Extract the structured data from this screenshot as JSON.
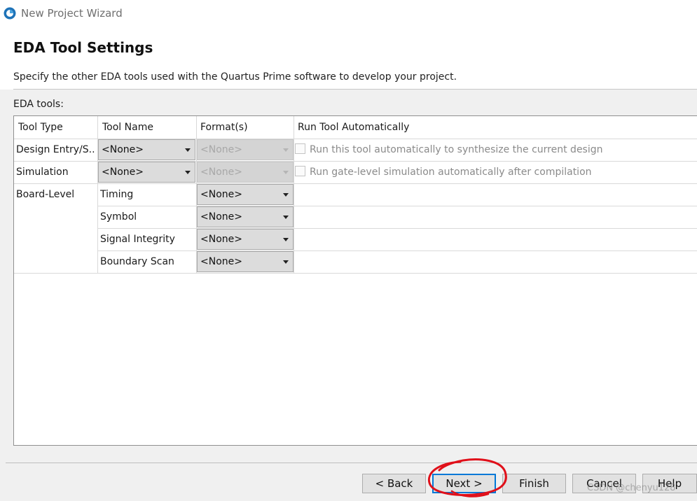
{
  "window": {
    "title": "New Project Wizard"
  },
  "header": {
    "title": "EDA Tool Settings",
    "description": "Specify the other EDA tools used with the Quartus Prime software to develop your project."
  },
  "eda_tools_label": "EDA tools:",
  "table": {
    "columns": [
      "Tool Type",
      "Tool Name",
      "Format(s)",
      "Run Tool Automatically"
    ],
    "rows": [
      {
        "tool_type": "Design Entry/S...",
        "tool_name": "<None>",
        "format": "<None>",
        "auto_text": "Run this tool automatically to synthesize the current design",
        "auto_checked": false
      },
      {
        "tool_type": "Simulation",
        "tool_name": "<None>",
        "format": "<None>",
        "auto_text": "Run gate-level simulation automatically after compilation",
        "auto_checked": false
      },
      {
        "tool_type": "Board-Level",
        "tool_name": "Timing",
        "format": "<None>"
      },
      {
        "tool_type": "",
        "tool_name": "Symbol",
        "format": "<None>"
      },
      {
        "tool_type": "",
        "tool_name": "Signal Integrity",
        "format": "<None>"
      },
      {
        "tool_type": "",
        "tool_name": "Boundary Scan",
        "format": "<None>"
      }
    ]
  },
  "buttons": {
    "back": "< Back",
    "next": "Next >",
    "finish": "Finish",
    "cancel": "Cancel",
    "help": "Help"
  },
  "watermark": "CSDN @chenyu128",
  "colors": {
    "accent": "#0078d7",
    "annotation": "#e0101a"
  }
}
